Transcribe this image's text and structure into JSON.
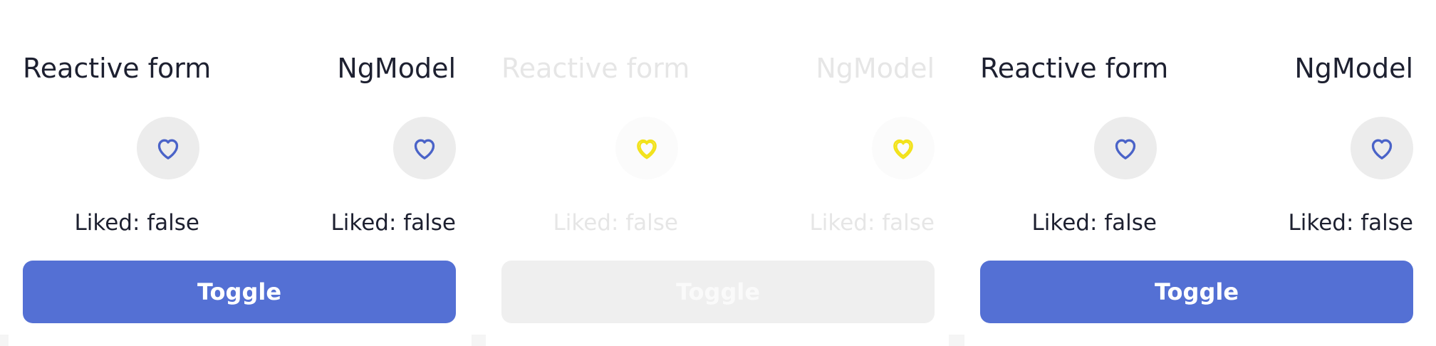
{
  "colors": {
    "accent": "#5470d4",
    "heart_stroke": "#4a63c8",
    "heart_disabled": "#f2e21a",
    "text": "#1d2030",
    "disabled_text": "#e6e6e6",
    "circle_bg": "#ececec"
  },
  "panels": [
    {
      "state": "enabled",
      "left_title": "Reactive form",
      "right_title": "NgModel",
      "left_liked": "Liked: false",
      "right_liked": "Liked: false",
      "left_icon": "heart-outline-icon",
      "right_icon": "heart-outline-icon",
      "toggle_label": "Toggle"
    },
    {
      "state": "disabled",
      "left_title": "Reactive form",
      "right_title": "NgModel",
      "left_liked": "Liked: false",
      "right_liked": "Liked: false",
      "left_icon": "heart-outline-icon",
      "right_icon": "heart-outline-icon",
      "toggle_label": "Toggle"
    },
    {
      "state": "enabled",
      "left_title": "Reactive form",
      "right_title": "NgModel",
      "left_liked": "Liked: false",
      "right_liked": "Liked: false",
      "left_icon": "heart-outline-icon",
      "right_icon": "heart-outline-icon",
      "toggle_label": "Toggle"
    }
  ]
}
